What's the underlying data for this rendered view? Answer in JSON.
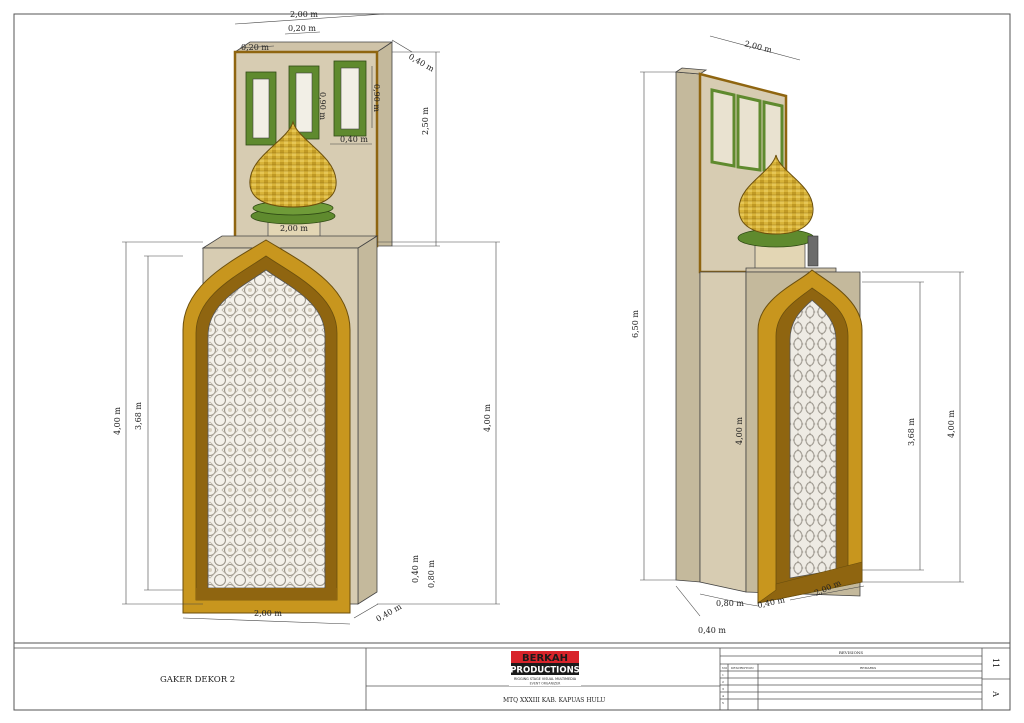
{
  "drawing": {
    "title": "GAKER DEKOR 2",
    "project": "MTQ XXXIII KAB. KAPUAS HULU",
    "sheet_number": "11",
    "revision_letter": "A"
  },
  "logo": {
    "brand": "BERKAH",
    "brand2": "PRODUCTIONS",
    "tagline": "RIGGING STAGE VISUAL MULTIMEDIA",
    "tagline2": "EVENT ORGANIZER"
  },
  "revisions": {
    "heading": "REVISIONS",
    "col_no": "NO",
    "col_description": "DESCRIPTION",
    "col_remarks": "REMARKS",
    "rows": [
      "1",
      "2",
      "3",
      "4",
      "5"
    ]
  },
  "front_view": {
    "top_width": "2,00 m",
    "window_width": "0,20 m",
    "window_gap": "0,20 m",
    "side_depth": "0,40 m",
    "window_height": "0,90 m",
    "window_height_b": "0,90 m",
    "window_bottom": "0,40 m",
    "upper_height": "2,50 m",
    "neck_width": "2,00 m",
    "total_height_left": "4,00 m",
    "arch_height": "3,68 m",
    "total_height_right": "4,00 m",
    "base_0_40": "0,40 m",
    "base_0_80": "0,80 m",
    "bottom_width": "2,00 m",
    "bottom_depth": "0,40 m"
  },
  "side_view": {
    "top_width": "2,00 m",
    "total_height": "6,50 m",
    "body_height": "4,00 m",
    "arch_height": "3,68 m",
    "right_height": "4,00 m",
    "base_0_80": "0,80 m",
    "base_0_40": "0,40 m",
    "bottom_0_40": "0,40 m",
    "bottom_width": "2,00 m"
  },
  "colors": {
    "wall": "#d7ccb2",
    "wall_shade": "#c4b99c",
    "gold": "#c8961e",
    "gold_dark": "#8f6510",
    "green": "#5f8a2e",
    "dome": "#d9b43a"
  }
}
